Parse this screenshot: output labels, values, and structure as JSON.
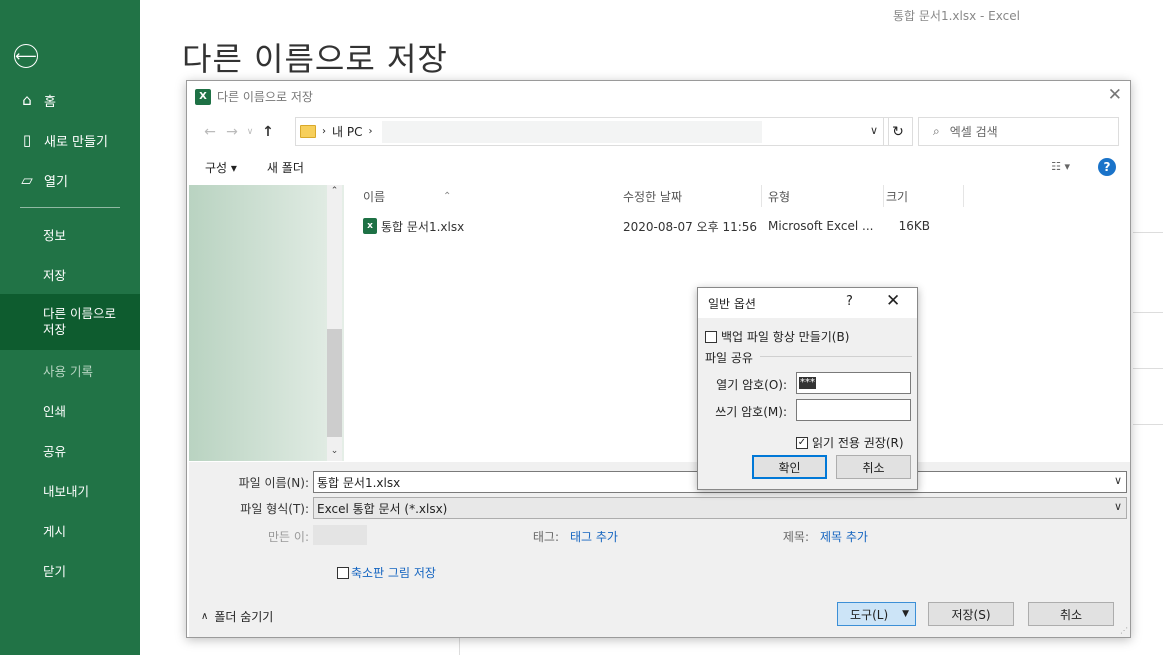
{
  "app": {
    "title": "통합 문서1.xlsx  -  Excel",
    "page_title": "다른 이름으로 저장"
  },
  "sidebar": {
    "back": "⟵",
    "top_items": [
      {
        "label": "홈",
        "icon": "home-icon"
      },
      {
        "label": "새로 만들기",
        "icon": "new-doc-icon"
      },
      {
        "label": "열기",
        "icon": "open-folder-icon"
      }
    ],
    "menu": [
      "정보",
      "저장",
      "다른 이름으로 저장",
      "사용 기록",
      "인쇄",
      "공유",
      "내보내기",
      "게시",
      "닫기"
    ]
  },
  "dialog": {
    "title": "다른 이름으로 저장",
    "breadcrumb": [
      "내 PC"
    ],
    "search_placeholder": "엑셀 검색",
    "toolbar": {
      "organize": "구성 ▾",
      "new_folder": "새 폴더"
    },
    "columns": [
      "이름",
      "수정한 날짜",
      "유형",
      "크기"
    ],
    "files": [
      {
        "name": "통합 문서1.xlsx",
        "date": "2020-08-07 오후 11:56",
        "type": "Microsoft Excel ...",
        "size": "16KB"
      }
    ],
    "filename_label": "파일 이름(N):",
    "filename_value": "통합 문서1.xlsx",
    "filetype_label": "파일 형식(T):",
    "filetype_value": "Excel 통합 문서 (*.xlsx)",
    "author_label": "만든 이:",
    "tags_label": "태그:",
    "tags_link": "태그 추가",
    "title_label": "제목:",
    "title_link": "제목 추가",
    "thumbnail_label": "축소판 그림 저장",
    "hide_folders": "폴더 숨기기",
    "tools": "도구(L)",
    "save": "저장(S)",
    "cancel": "취소"
  },
  "general_options": {
    "title": "일반 옵션",
    "help": "?",
    "backup_label": "백업 파일 항상 만들기(B)",
    "section": "파일 공유",
    "open_pw_label": "열기 암호(O):",
    "open_pw_value": "***",
    "write_pw_label": "쓰기 암호(M):",
    "write_pw_value": "",
    "readonly_label": "읽기 전용 권장(R)",
    "ok": "확인",
    "cancel": "취소"
  }
}
